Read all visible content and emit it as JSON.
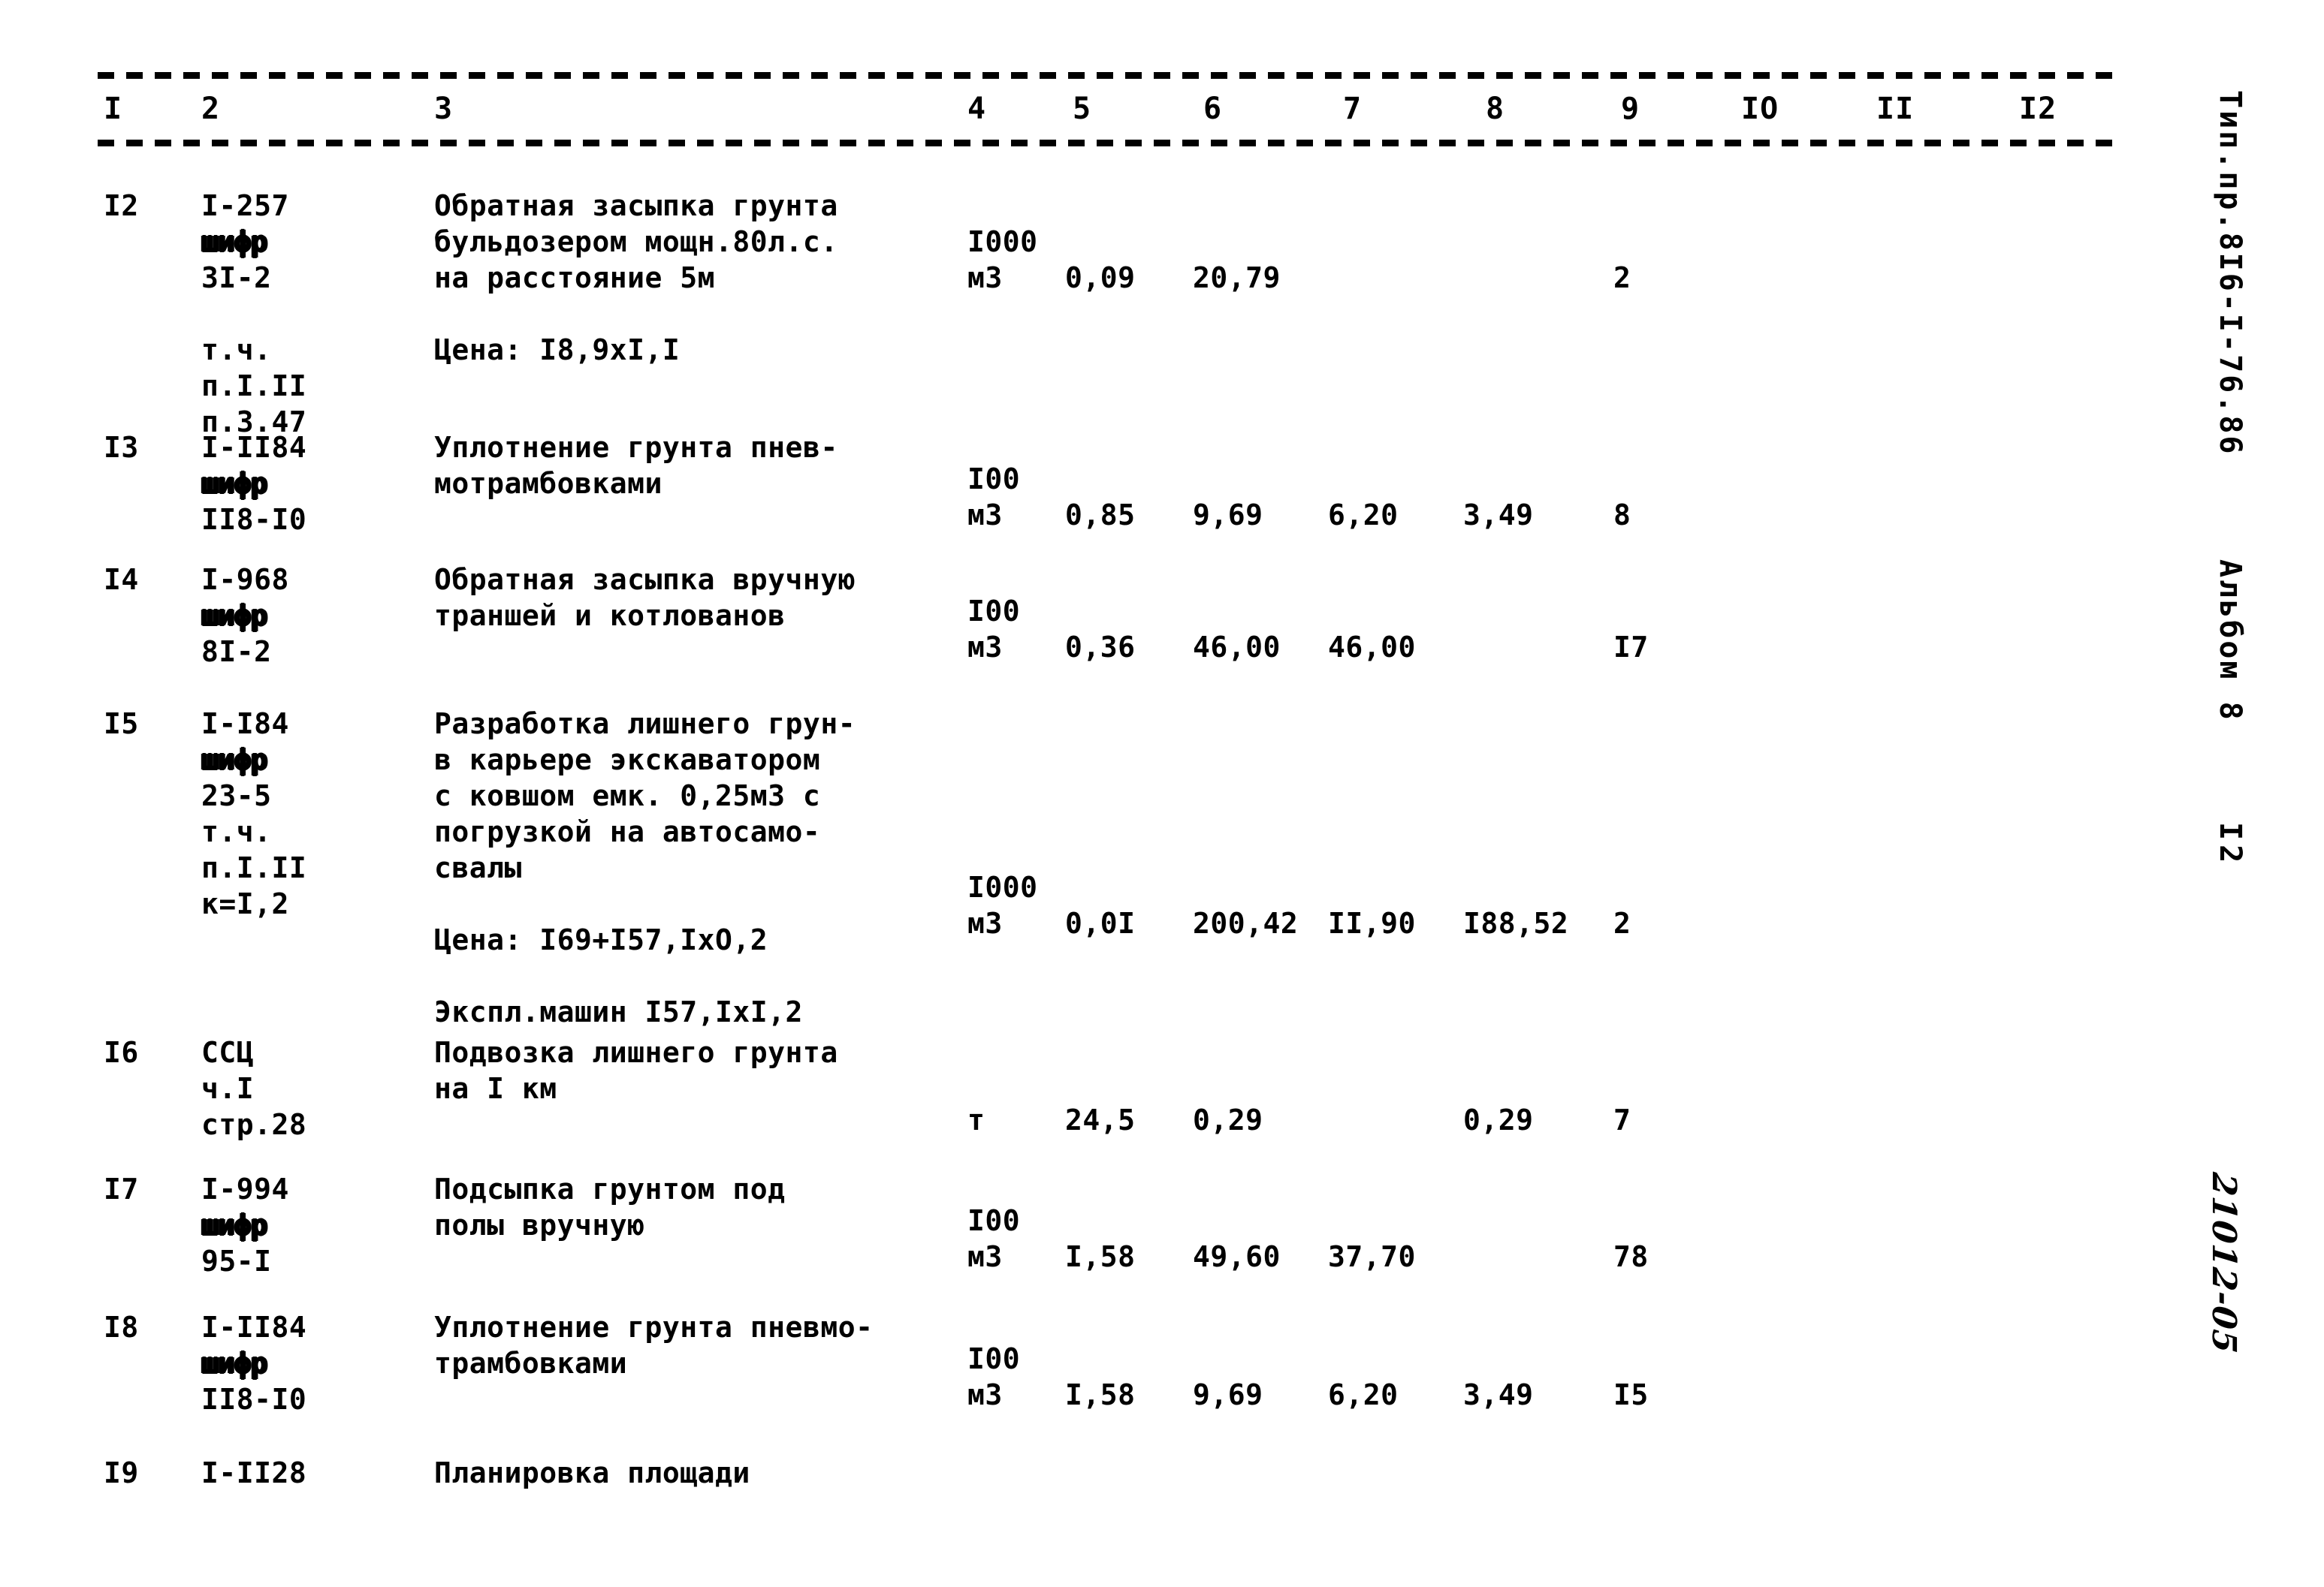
{
  "document": {
    "kind": "scanned-cost-estimate-table",
    "page_background": "#ffffff",
    "ink_color": "#000000"
  },
  "table": {
    "column_headers": [
      "I",
      "2",
      "3",
      "4",
      "5",
      "6",
      "7",
      "8",
      "9",
      "IO",
      "II",
      "I2"
    ],
    "rows": [
      {
        "no": "I2",
        "code": "I-257\nшифр\n3I-2\n\nт.ч.\nп.I.II\nп.3.47",
        "code_lines": [
          "I-257",
          "шифр",
          "3I-2",
          "",
          "т.ч.",
          "п.I.II",
          "п.3.47"
        ],
        "description_lines": [
          "Обратная засыпка грунта",
          "бульдозером мощн.80л.с.",
          "на расстояние 5м",
          "",
          "Цена: I8,9xI,I"
        ],
        "unit_lines": [
          "I000",
          "м3"
        ],
        "c5": "0,09",
        "c6": "20,79",
        "c7": "",
        "c8": "",
        "c9": "2"
      },
      {
        "no": "I3",
        "code_lines": [
          "I-II84",
          "шифр",
          "II8-I0"
        ],
        "description_lines": [
          "Уплотнение грунта пнев-",
          "мотрамбовками"
        ],
        "unit_lines": [
          "I00",
          "м3"
        ],
        "c5": "0,85",
        "c6": "9,69",
        "c7": "6,20",
        "c8": "3,49",
        "c9": "8"
      },
      {
        "no": "I4",
        "code_lines": [
          "I-968",
          "шифр",
          "8I-2"
        ],
        "description_lines": [
          "Обратная засыпка вручную",
          "траншей и котлованов"
        ],
        "unit_lines": [
          "I00",
          "м3"
        ],
        "c5": "0,36",
        "c6": "46,00",
        "c7": "46,00",
        "c8": "",
        "c9": "I7"
      },
      {
        "no": "I5",
        "code_lines": [
          "I-I84",
          "шифр",
          "23-5",
          "т.ч.",
          "п.I.II",
          "к=I,2"
        ],
        "description_lines": [
          "Разработка лишнего грун-",
          "в карьере экскаватором",
          "с ковшом емк. 0,25м3 с",
          "погрузкой на автосамо-",
          "свалы",
          "",
          "Цена: I69+I57,IxО,2",
          "",
          "Экспл.машин I57,IxI,2"
        ],
        "unit_lines": [
          "I000",
          "м3"
        ],
        "c5": "0,0I",
        "c6": "200,42",
        "c7": "II,90",
        "c8": "I88,52",
        "c9": "2"
      },
      {
        "no": "I6",
        "code_lines": [
          "ССЦ",
          "ч.I",
          "стр.28"
        ],
        "description_lines": [
          "Подвозка лишнего грунта",
          "на I км"
        ],
        "unit_lines": [
          "т"
        ],
        "c5": "24,5",
        "c6": "0,29",
        "c7": "",
        "c8": "0,29",
        "c9": "7"
      },
      {
        "no": "I7",
        "code_lines": [
          "I-994",
          "шифр",
          "95-I"
        ],
        "description_lines": [
          "Подсыпка грунтом под",
          "полы вручную"
        ],
        "unit_lines": [
          "I00",
          "м3"
        ],
        "c5": "I,58",
        "c6": "49,60",
        "c7": "37,70",
        "c8": "",
        "c9": "78"
      },
      {
        "no": "I8",
        "code_lines": [
          "I-II84",
          "шифр",
          "II8-I0"
        ],
        "description_lines": [
          "Уплотнение грунта пневмо-",
          "трамбовками"
        ],
        "unit_lines": [
          "I00",
          "м3"
        ],
        "c5": "I,58",
        "c6": "9,69",
        "c7": "6,20",
        "c8": "3,49",
        "c9": "I5"
      },
      {
        "no": "I9",
        "code_lines": [
          "I-II28"
        ],
        "description_lines": [
          "Планировка площади"
        ],
        "unit_lines": [],
        "c5": "",
        "c6": "",
        "c7": "",
        "c8": "",
        "c9": ""
      }
    ]
  },
  "margin": {
    "project_ref": "Тип.пр.8I6-I-76.86",
    "album": "Альбом 8",
    "page_number": "I2",
    "handwritten_mark": "21012-05"
  }
}
